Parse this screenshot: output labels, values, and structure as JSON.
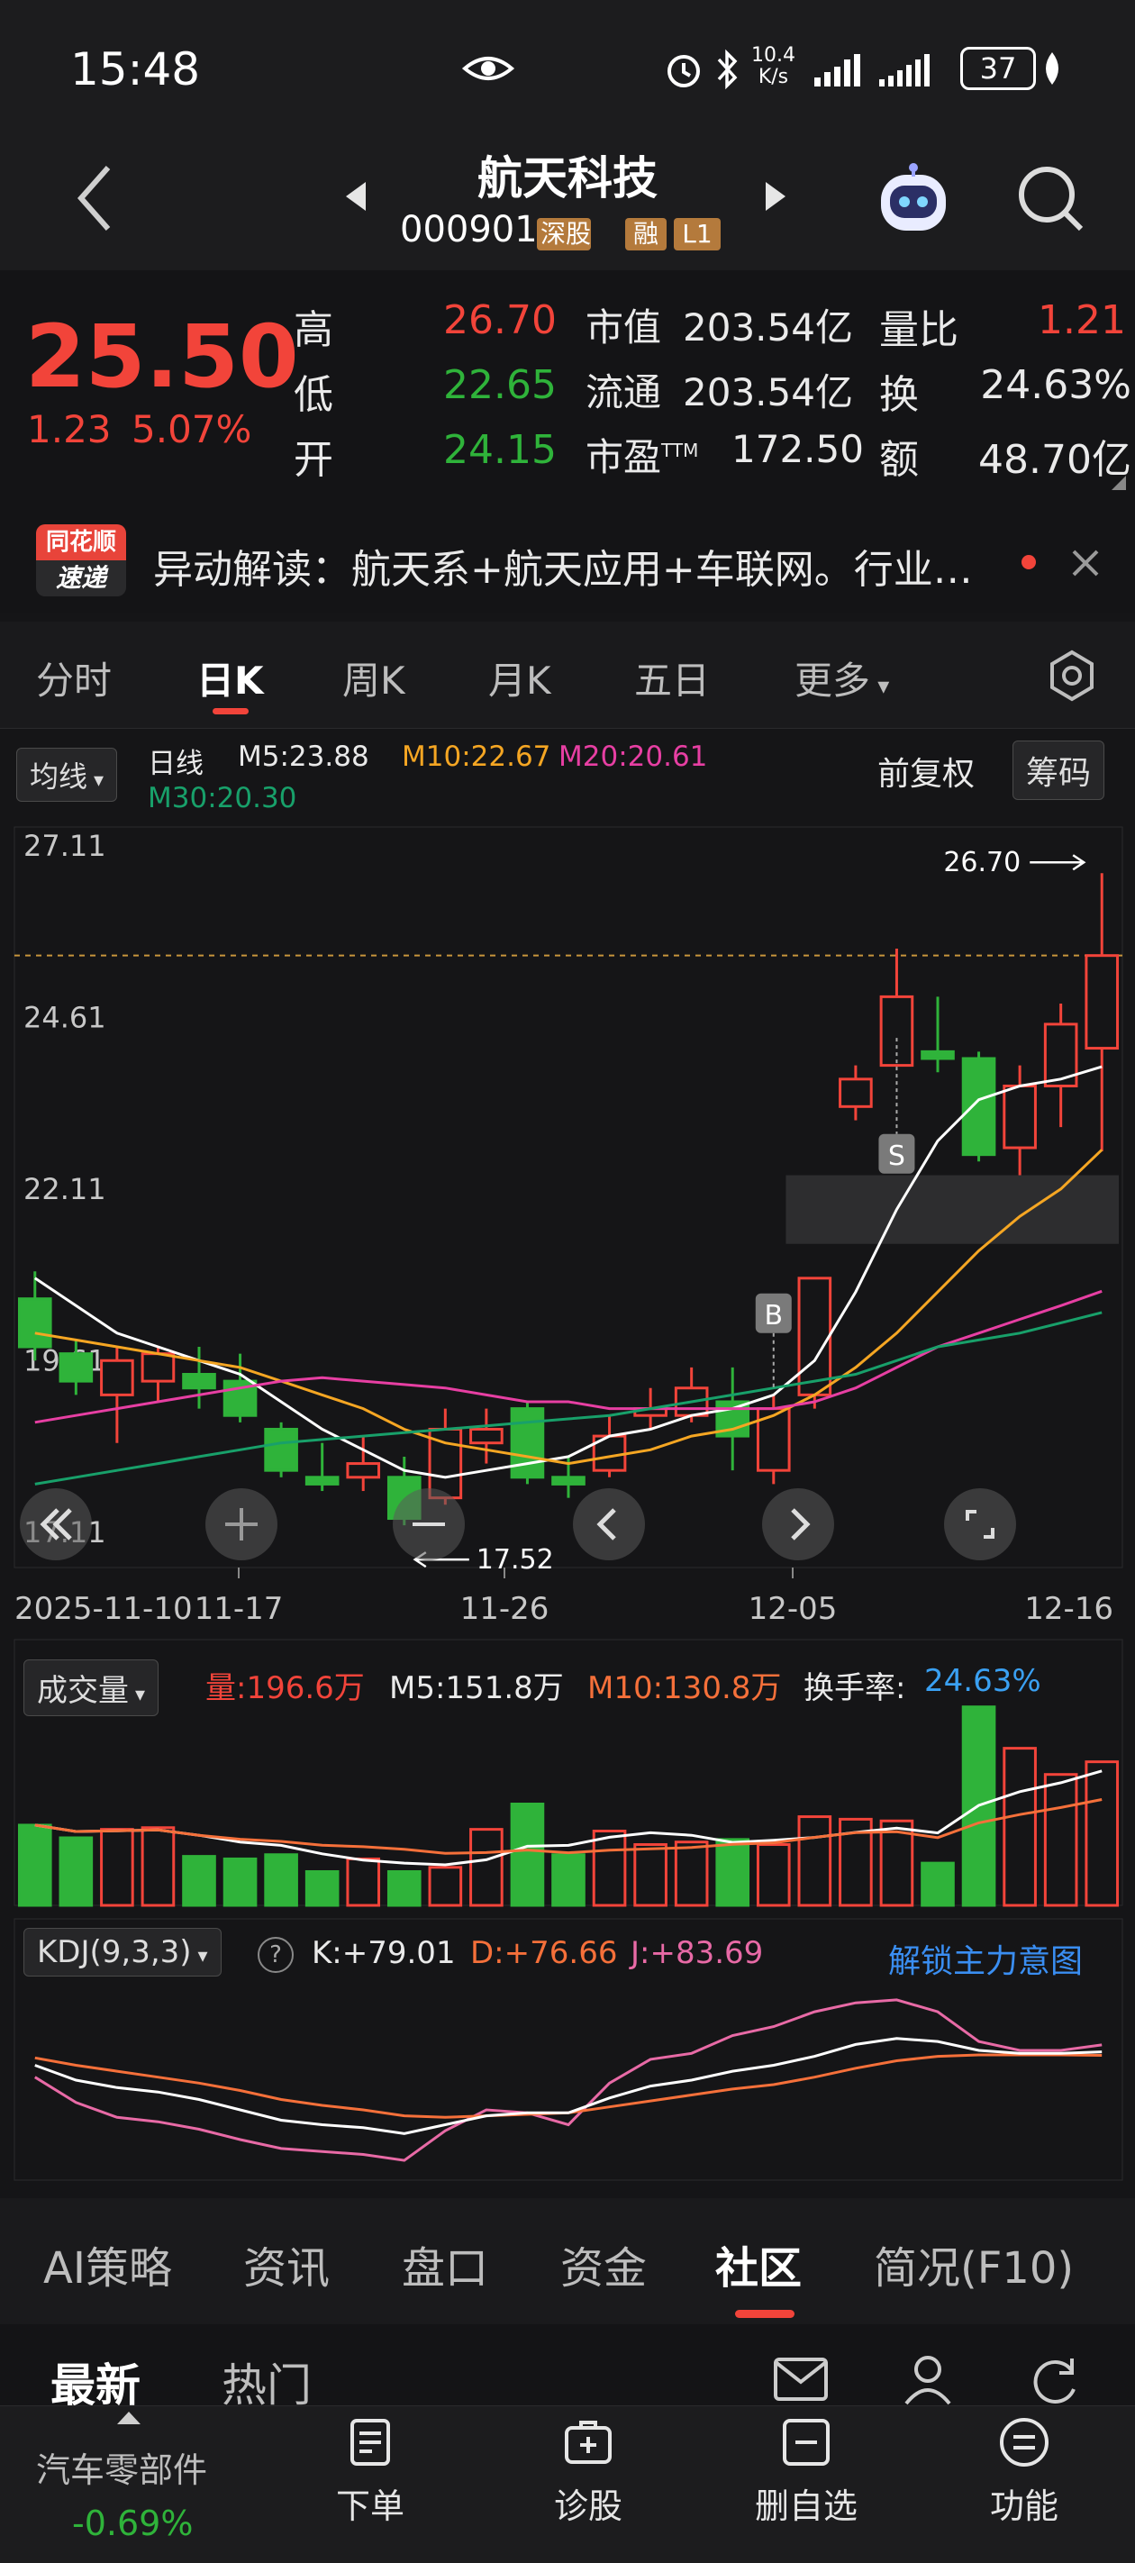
{
  "status": {
    "time": "15:48",
    "net_speed_top": "10.4",
    "net_speed_bottom": "K/s",
    "battery": "37"
  },
  "header": {
    "stock_name": "航天科技",
    "stock_code": "000901",
    "badge_tong": "深股通",
    "badge_rong": "融",
    "badge_l1": "L1"
  },
  "quote": {
    "price": "25.50",
    "change": "1.23",
    "change_pct": "5.07%",
    "high_label": "高",
    "high": "26.70",
    "low_label": "低",
    "low": "22.65",
    "open_label": "开",
    "open": "24.15",
    "mktcap_label": "市值",
    "mktcap": "203.54亿",
    "float_label": "流通",
    "float": "203.54亿",
    "pe_label": "市盈",
    "pe_sup": "TTM",
    "pe": "172.50",
    "vr_label": "量比",
    "vr": "1.21",
    "turnover_label": "换",
    "turnover": "24.63%",
    "amount_label": "额",
    "amount": "48.70亿"
  },
  "news": {
    "logo_top": "同花顺",
    "logo_bottom": "速递",
    "text": "异动解读：航天系+航天应用+车联网。行业…"
  },
  "tabs": [
    "分时",
    "日K",
    "周K",
    "月K",
    "五日",
    "更多"
  ],
  "kline_legend": {
    "selector": "均线",
    "daily": "日线",
    "m5": "M5:23.88",
    "m10": "M10:22.67",
    "m20": "M20:20.61",
    "m30": "M30:20.30",
    "adjust": "前复权",
    "chips": "筹码",
    "max_label": "26.70",
    "min_label": "17.52",
    "buy_mark": "B",
    "sell_mark": "S",
    "colors": {
      "up": "#f2443a",
      "down": "#2fb33a",
      "m5": "#ffffff",
      "m10": "#f5a623",
      "m20": "#e73fa3",
      "m30": "#18a06a"
    }
  },
  "chart_data": {
    "type": "candlestick",
    "title": "",
    "yticks": [
      "27.11",
      "24.61",
      "22.11",
      "19.61",
      "17.11"
    ],
    "xticks": [
      "2025-11-10",
      "11-17",
      "11-26",
      "12-05",
      "12-16"
    ],
    "ylim": [
      17.11,
      27.11
    ],
    "candles": [
      {
        "o": 20.5,
        "c": 19.8,
        "h": 20.9,
        "l": 19.6
      },
      {
        "o": 19.7,
        "c": 19.3,
        "h": 19.9,
        "l": 19.1
      },
      {
        "o": 19.1,
        "c": 19.6,
        "h": 19.8,
        "l": 18.4
      },
      {
        "o": 19.3,
        "c": 19.7,
        "h": 19.8,
        "l": 19.0
      },
      {
        "o": 19.4,
        "c": 19.2,
        "h": 19.8,
        "l": 18.9
      },
      {
        "o": 19.3,
        "c": 18.8,
        "h": 19.7,
        "l": 18.7
      },
      {
        "o": 18.6,
        "c": 18.0,
        "h": 18.7,
        "l": 17.9
      },
      {
        "o": 17.9,
        "c": 17.8,
        "h": 18.4,
        "l": 17.7
      },
      {
        "o": 17.9,
        "c": 18.1,
        "h": 18.5,
        "l": 17.7
      },
      {
        "o": 17.9,
        "c": 17.3,
        "h": 18.2,
        "l": 17.2
      },
      {
        "o": 17.6,
        "c": 18.6,
        "h": 18.9,
        "l": 17.5
      },
      {
        "o": 18.4,
        "c": 18.6,
        "h": 18.9,
        "l": 18.1
      },
      {
        "o": 18.9,
        "c": 17.9,
        "h": 19.0,
        "l": 17.8
      },
      {
        "o": 17.9,
        "c": 17.8,
        "h": 18.2,
        "l": 17.6
      },
      {
        "o": 18.0,
        "c": 18.5,
        "h": 18.8,
        "l": 17.9
      },
      {
        "o": 18.8,
        "c": 18.9,
        "h": 19.2,
        "l": 18.6
      },
      {
        "o": 18.8,
        "c": 19.2,
        "h": 19.5,
        "l": 18.7
      },
      {
        "o": 19.0,
        "c": 18.5,
        "h": 19.5,
        "l": 18.0
      },
      {
        "o": 18.0,
        "c": 18.9,
        "h": 19.1,
        "l": 17.8
      },
      {
        "o": 19.1,
        "c": 20.8,
        "h": 20.8,
        "l": 18.9
      },
      {
        "o": 23.3,
        "c": 23.7,
        "h": 23.9,
        "l": 23.1
      },
      {
        "o": 23.9,
        "c": 24.9,
        "h": 25.6,
        "l": 23.9
      },
      {
        "o": 24.1,
        "c": 24.0,
        "h": 24.9,
        "l": 23.8
      },
      {
        "o": 24.0,
        "c": 22.6,
        "h": 24.1,
        "l": 22.5
      },
      {
        "o": 22.7,
        "c": 23.6,
        "h": 23.9,
        "l": 22.3
      },
      {
        "o": 23.6,
        "c": 24.5,
        "h": 24.8,
        "l": 23.0
      },
      {
        "o": 24.15,
        "c": 25.5,
        "h": 26.7,
        "l": 22.65
      }
    ],
    "ma": {
      "M5": [
        20.8,
        20.4,
        20.0,
        19.8,
        19.6,
        19.4,
        19.0,
        18.6,
        18.3,
        18.0,
        17.9,
        18.0,
        18.1,
        18.2,
        18.5,
        18.6,
        18.8,
        18.9,
        19.1,
        19.6,
        20.6,
        21.8,
        22.8,
        23.4,
        23.6,
        23.7,
        23.88
      ],
      "M10": [
        20.0,
        19.9,
        19.8,
        19.7,
        19.6,
        19.5,
        19.3,
        19.1,
        18.9,
        18.6,
        18.4,
        18.3,
        18.2,
        18.1,
        18.2,
        18.3,
        18.5,
        18.6,
        18.8,
        19.1,
        19.5,
        20.0,
        20.6,
        21.2,
        21.7,
        22.1,
        22.67
      ],
      "M20": [
        18.7,
        18.8,
        18.9,
        19.0,
        19.1,
        19.2,
        19.3,
        19.35,
        19.3,
        19.25,
        19.2,
        19.1,
        19.0,
        19.0,
        18.9,
        18.9,
        18.9,
        18.9,
        18.9,
        19.0,
        19.2,
        19.5,
        19.8,
        20.0,
        20.2,
        20.4,
        20.61
      ],
      "M30": [
        17.8,
        17.9,
        18.0,
        18.1,
        18.2,
        18.3,
        18.4,
        18.45,
        18.5,
        18.55,
        18.6,
        18.65,
        18.7,
        18.75,
        18.8,
        18.9,
        19.0,
        19.1,
        19.2,
        19.3,
        19.4,
        19.6,
        19.8,
        19.9,
        20.0,
        20.15,
        20.3
      ]
    },
    "volume": {
      "label": "成交量",
      "vol_label": "量:196.6万",
      "m5_label": "M5:151.8万",
      "m10_label": "M10:130.8万",
      "turnover_label": "换手率:",
      "turnover_value": "24.63%",
      "values": [
        95,
        80,
        90,
        92,
        58,
        55,
        60,
        40,
        55,
        40,
        45,
        90,
        120,
        60,
        88,
        72,
        75,
        78,
        72,
        105,
        102,
        100,
        50,
        235,
        186,
        155,
        170
      ]
    },
    "kdj": {
      "label": "KDJ(9,3,3)",
      "k_label": "K:+79.01",
      "d_label": "D:+76.66",
      "j_label": "J:+83.69",
      "unlock": "解锁主力意图",
      "K": [
        70,
        60,
        55,
        52,
        47,
        40,
        33,
        30,
        28,
        24,
        30,
        36,
        38,
        38,
        48,
        56,
        60,
        66,
        70,
        76,
        84,
        88,
        86,
        80,
        78,
        78,
        79.01
      ],
      "D": [
        75,
        70,
        66,
        62,
        58,
        53,
        47,
        43,
        40,
        36,
        35,
        36,
        37,
        38,
        42,
        46,
        50,
        54,
        57,
        62,
        68,
        73,
        76,
        77,
        77,
        77,
        76.66
      ],
      "J": [
        62,
        45,
        35,
        32,
        27,
        20,
        14,
        12,
        10,
        6,
        26,
        40,
        38,
        30,
        58,
        74,
        78,
        90,
        96,
        106,
        112,
        114,
        106,
        86,
        80,
        80,
        83.69
      ]
    }
  },
  "bottom_tabs": [
    "AI策略",
    "资讯",
    "盘口",
    "资金",
    "社区",
    "简况(F10)"
  ],
  "sub_tabs": [
    "最新",
    "热门"
  ],
  "toolbar": {
    "sector_name": "汽车零部件",
    "sector_change": "-0.69%",
    "order": "下单",
    "diagnose": "诊股",
    "remove": "删自选",
    "function": "功能"
  }
}
